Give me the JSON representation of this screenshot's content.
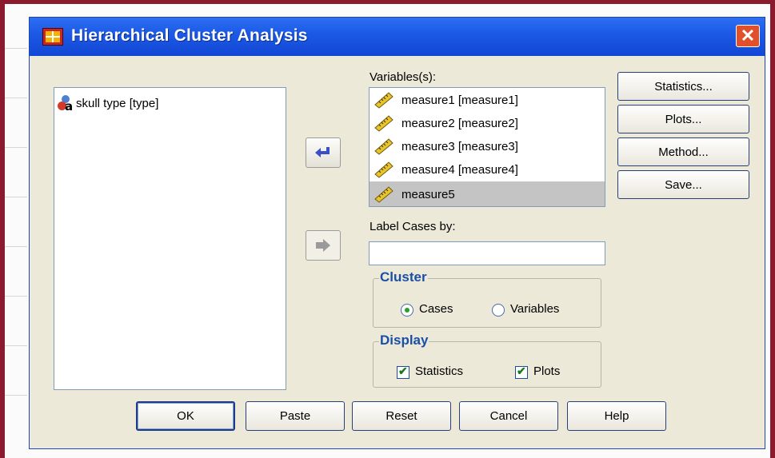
{
  "window": {
    "title": "Hierarchical Cluster Analysis",
    "close_glyph": "✕"
  },
  "source_list": {
    "items": [
      {
        "label": "skull type [type]",
        "icon": "nominal-variable-icon"
      }
    ]
  },
  "variables": {
    "label": "Variables(s):",
    "items": [
      {
        "label": "measure1 [measure1]",
        "icon": "scale-ruler-icon",
        "selected": false
      },
      {
        "label": "measure2 [measure2]",
        "icon": "scale-ruler-icon",
        "selected": false
      },
      {
        "label": "measure3 [measure3]",
        "icon": "scale-ruler-icon",
        "selected": false
      },
      {
        "label": "measure4 [measure4]",
        "icon": "scale-ruler-icon",
        "selected": false
      },
      {
        "label": "measure5",
        "icon": "scale-ruler-icon",
        "selected": true
      }
    ]
  },
  "label_cases": {
    "label": "Label Cases by:",
    "value": ""
  },
  "cluster": {
    "title": "Cluster",
    "options": [
      {
        "label": "Cases",
        "checked": true
      },
      {
        "label": "Variables",
        "checked": false
      }
    ]
  },
  "display": {
    "title": "Display",
    "options": [
      {
        "label": "Statistics",
        "checked": true
      },
      {
        "label": "Plots",
        "checked": true
      }
    ]
  },
  "side_buttons": {
    "statistics": "Statistics...",
    "plots": "Plots...",
    "method": "Method...",
    "save": "Save..."
  },
  "bottom_buttons": {
    "ok": "OK",
    "paste": "Paste",
    "reset": "Reset",
    "cancel": "Cancel",
    "help": "Help"
  },
  "colors": {
    "titlebar": "#1c5ae6",
    "dialog_bg": "#ece9d8",
    "group_title": "#1a4fa8",
    "page_frame": "#8b1a2e"
  }
}
